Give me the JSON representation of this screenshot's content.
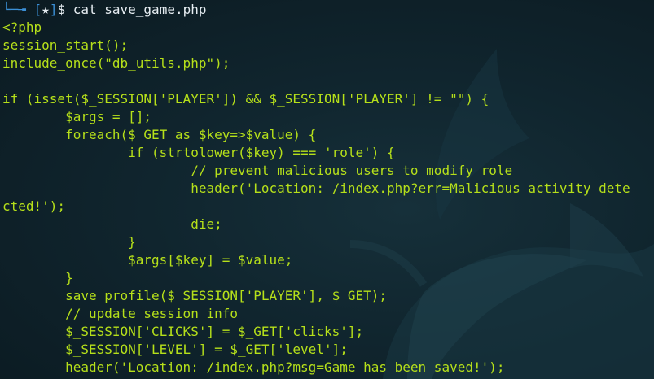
{
  "prompt": {
    "corner": "└─╼ ",
    "bracket_open": "[",
    "status": "★",
    "bracket_close": "]",
    "symbol": "$",
    "command": " cat save_game.php"
  },
  "code_lines": [
    "<?php",
    "session_start();",
    "include_once(\"db_utils.php\");",
    "",
    "if (isset($_SESSION['PLAYER']) && $_SESSION['PLAYER'] != \"\") {",
    "        $args = [];",
    "        foreach($_GET as $key=>$value) {",
    "                if (strtolower($key) === 'role') {",
    "                        // prevent malicious users to modify role",
    "                        header('Location: /index.php?err=Malicious activity dete",
    "cted!');",
    "                        die;",
    "                }",
    "                $args[$key] = $value;",
    "        }",
    "        save_profile($_SESSION['PLAYER'], $_GET);",
    "        // update session info",
    "        $_SESSION['CLICKS'] = $_GET['clicks'];",
    "        $_SESSION['LEVEL'] = $_GET['level'];",
    "        header('Location: /index.php?msg=Game has been saved!');"
  ],
  "colors": {
    "background": "#10252e",
    "code_text": "#b6e01a",
    "prompt_accent": "#3b8fd6",
    "prompt_text": "#e6edf2"
  },
  "wallpaper": {
    "icon": "kali-dragon-watermark-icon"
  }
}
